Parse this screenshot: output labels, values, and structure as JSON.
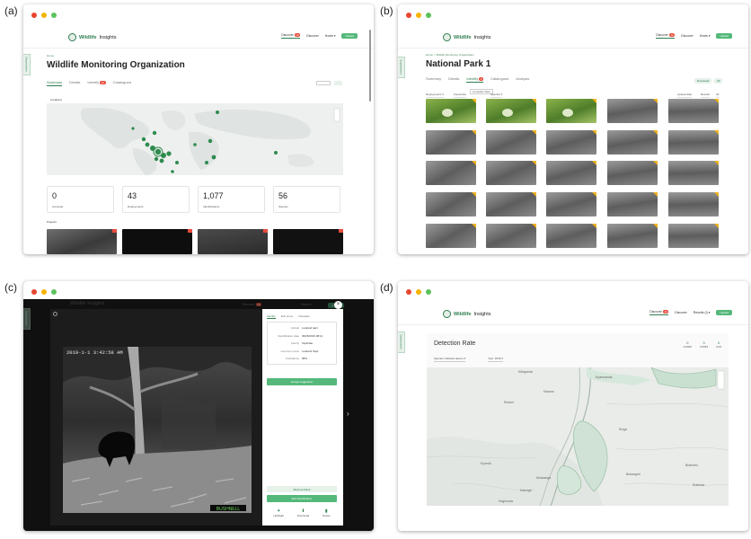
{
  "panel_labels": [
    "(a)",
    "(b)",
    "(c)",
    "(d)"
  ],
  "brand": {
    "logo_text_1": "Wildlife",
    "logo_text_2": "Insights",
    "accent": "#2e7d4f",
    "badge": "#e74c3c",
    "flag": "#f2b21b"
  },
  "nav": {
    "item1": "Discover",
    "item1_badge": "12",
    "item2": "Discover",
    "item3": "Hosts",
    "user_d": "Results (I)",
    "button": "Upload"
  },
  "sidebar_tab": "Organization",
  "panel_a": {
    "breadcrumb": "Home",
    "title": "Wildlife Monitoring Organization",
    "tabs": [
      "Summary",
      "Details",
      "Identify",
      "Catalogued"
    ],
    "identify_badge": "12",
    "map_section": "Locations",
    "stats": [
      {
        "value": "0",
        "label": "Cameras"
      },
      {
        "value": "43",
        "label": "Deployments"
      },
      {
        "value": "1,077",
        "label": "Identifications"
      },
      {
        "value": "56",
        "label": "Species"
      }
    ],
    "projects_label": "Projects"
  },
  "panel_b": {
    "breadcrumb": "Home > Wildlife Monitoring Organization",
    "title": "National Park 1",
    "tabs": [
      "Summary",
      "Details",
      "Identify",
      "Catalogued",
      "Analysis"
    ],
    "identify_badge": "9",
    "filters": [
      "Deployments",
      "Favourites",
      "Species"
    ],
    "filter_chip": "Complete Sets",
    "right_controls": [
      "Upload date",
      "Results",
      "All"
    ],
    "header_pills": [
      "Download",
      "All"
    ]
  },
  "panel_c": {
    "tabs": [
      "Identify",
      "Edit photo",
      "Metadata"
    ],
    "details": [
      {
        "k": "Animal",
        "v": "Lowland tapir"
      },
      {
        "k": "Identification date",
        "v": "06/26/2019 08:11"
      },
      {
        "k": "Family",
        "v": "Tapiridae"
      },
      {
        "k": "Common name",
        "v": "Lowland Tapir"
      },
      {
        "k": "Confidence",
        "v": "98%"
      }
    ],
    "suggestion_button": "Accept suggestion",
    "mark_button": "Mark as blank",
    "edit_button": "Edit identification",
    "actions": [
      "Highlight",
      "Download",
      "Delete"
    ],
    "stamp": "2019-1-1 3:42:58 AM",
    "cam_brand": "BUSHNELL"
  },
  "panel_d": {
    "title": "Detection Rate",
    "species_select": "Species: Dasiatis tapirus",
    "year_select": "Year: 2018",
    "legend": [
      {
        "value": "0",
        "label": "0.0006"
      },
      {
        "value": "0",
        "label": "0.0053"
      },
      {
        "value": "0",
        "label": "0.09"
      }
    ],
    "places": [
      "Kiteganda",
      "Ruboni",
      "Kasese",
      "Kyamzanda",
      "Kinga",
      "Bukangeri",
      "Butembo",
      "Rubinda",
      "Kyondo",
      "Mutwanga",
      "Kalonge",
      "Kaghonda"
    ]
  }
}
